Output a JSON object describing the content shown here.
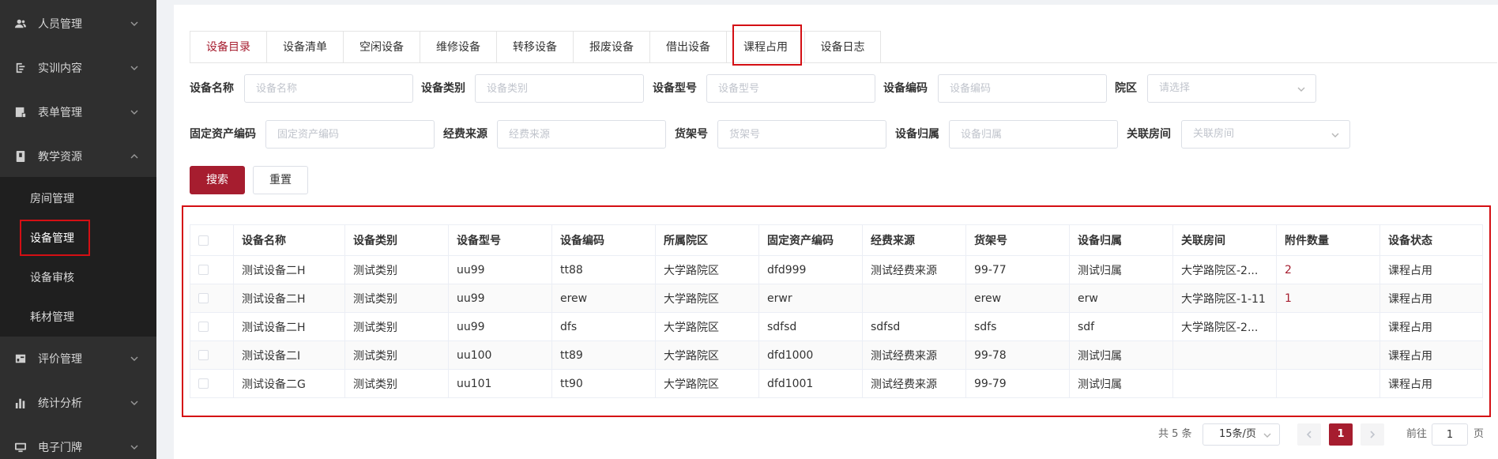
{
  "sidebar": {
    "items": [
      {
        "label": "人员管理",
        "icon": "users-icon"
      },
      {
        "label": "实训内容",
        "icon": "training-icon"
      },
      {
        "label": "表单管理",
        "icon": "form-icon"
      },
      {
        "label": "教学资源",
        "icon": "book-icon"
      },
      {
        "label": "评价管理",
        "icon": "evaluation-icon"
      },
      {
        "label": "统计分析",
        "icon": "bar-chart-icon"
      },
      {
        "label": "电子门牌",
        "icon": "monitor-icon"
      }
    ],
    "submenu": [
      {
        "label": "房间管理"
      },
      {
        "label": "设备管理"
      },
      {
        "label": "设备审核"
      },
      {
        "label": "耗材管理"
      }
    ]
  },
  "tabs": [
    {
      "label": "设备目录"
    },
    {
      "label": "设备清单"
    },
    {
      "label": "空闲设备"
    },
    {
      "label": "维修设备"
    },
    {
      "label": "转移设备"
    },
    {
      "label": "报废设备"
    },
    {
      "label": "借出设备"
    },
    {
      "label": "课程占用"
    },
    {
      "label": "设备日志"
    }
  ],
  "filters": {
    "name": {
      "label": "设备名称",
      "placeholder": "设备名称"
    },
    "category": {
      "label": "设备类别",
      "placeholder": "设备类别"
    },
    "model": {
      "label": "设备型号",
      "placeholder": "设备型号"
    },
    "code": {
      "label": "设备编码",
      "placeholder": "设备编码"
    },
    "campus": {
      "label": "院区",
      "placeholder": "请选择"
    },
    "asset_code": {
      "label": "固定资产编码",
      "placeholder": "固定资产编码"
    },
    "fund": {
      "label": "经费来源",
      "placeholder": "经费来源"
    },
    "shelf": {
      "label": "货架号",
      "placeholder": "货架号"
    },
    "owner": {
      "label": "设备归属",
      "placeholder": "设备归属"
    },
    "room": {
      "label": "关联房间",
      "placeholder": "关联房间"
    }
  },
  "buttons": {
    "search": "搜索",
    "reset": "重置"
  },
  "table": {
    "headers": [
      "设备名称",
      "设备类别",
      "设备型号",
      "设备编码",
      "所属院区",
      "固定资产编码",
      "经费来源",
      "货架号",
      "设备归属",
      "关联房间",
      "附件数量",
      "设备状态"
    ],
    "rows": [
      [
        "测试设备二H",
        "测试类别",
        "uu99",
        "tt88",
        "大学路院区",
        "dfd999",
        "测试经费来源",
        "99-77",
        "测试归属",
        "大学路院区-2...",
        "2",
        "课程占用"
      ],
      [
        "测试设备二H",
        "测试类别",
        "uu99",
        "erew",
        "大学路院区",
        "erwr",
        "",
        "erew",
        "erw",
        "大学路院区-1-11",
        "1",
        "课程占用"
      ],
      [
        "测试设备二H",
        "测试类别",
        "uu99",
        "dfs",
        "大学路院区",
        "sdfsd",
        "sdfsd",
        "sdfs",
        "sdf",
        "大学路院区-2...",
        "",
        "课程占用"
      ],
      [
        "测试设备二I",
        "测试类别",
        "uu100",
        "tt89",
        "大学路院区",
        "dfd1000",
        "测试经费来源",
        "99-78",
        "测试归属",
        "",
        "",
        "课程占用"
      ],
      [
        "测试设备二G",
        "测试类别",
        "uu101",
        "tt90",
        "大学路院区",
        "dfd1001",
        "测试经费来源",
        "99-79",
        "测试归属",
        "",
        "",
        "课程占用"
      ]
    ]
  },
  "pagination": {
    "total": "共 5 条",
    "page_size": "15条/页",
    "current_page": "1",
    "goto_prefix": "前往",
    "goto_value": "1",
    "goto_suffix": "页"
  },
  "colors": {
    "accent": "#a61d2f",
    "highlight_box": "#d40f14",
    "sidebar_bg": "#2f2f2f",
    "submenu_bg": "#1f1f1f"
  }
}
